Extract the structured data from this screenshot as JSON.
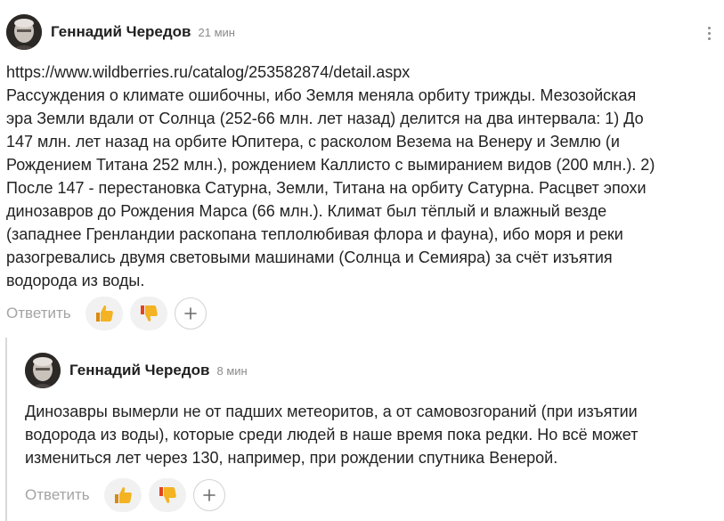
{
  "comment": {
    "author": "Геннадий Чередов",
    "time": "21 мин",
    "link": "https://www.wildberries.ru/catalog/253582874/detail.aspx",
    "text": "Рассуждения о климате ошибочны, ибо Земля меняла орбиту трижды. Мезозойская\nэра Земли вдали от Солнца (252-66 млн. лет назад) делится на два интервала: 1) До\n147 млн. лет назад на орбите Юпитера, с расколом Везема на Венеру и Землю (и\nРождением Титана 252 млн.), рождением Каллисто с вымиранием видов (200 млн.). 2)\nПосле 147 - перестановка Сатурна, Земли, Титана на орбиту Сатурна. Расцвет эпохи\nдинозавров до Рождения Марса (66 млн.). Климат был тёплый и влажный везде\n(западнее Гренландии раскопана теплолюбивая флора и фауна), ибо моря и реки\nразогревались двумя световыми машинами (Солнца и Семияра) за счёт изъятия\nводорода из воды.",
    "reply_label": "Ответить"
  },
  "reply": {
    "author": "Геннадий Чередов",
    "time": "8 мин",
    "text": "Динозавры вымерли не от падших метеоритов, а от самовозгораний (при изъятии\nводорода из воды), которые среди людей в наше время пока редки. Но всё может\nизмениться лет через 130, например, при рождении спутника Венерой.",
    "reply_label": "Ответить"
  },
  "icons": {
    "like": "thumbs-up-icon",
    "dislike": "thumbs-down-icon",
    "add": "plus-icon",
    "menu": "more-vertical-icon"
  }
}
